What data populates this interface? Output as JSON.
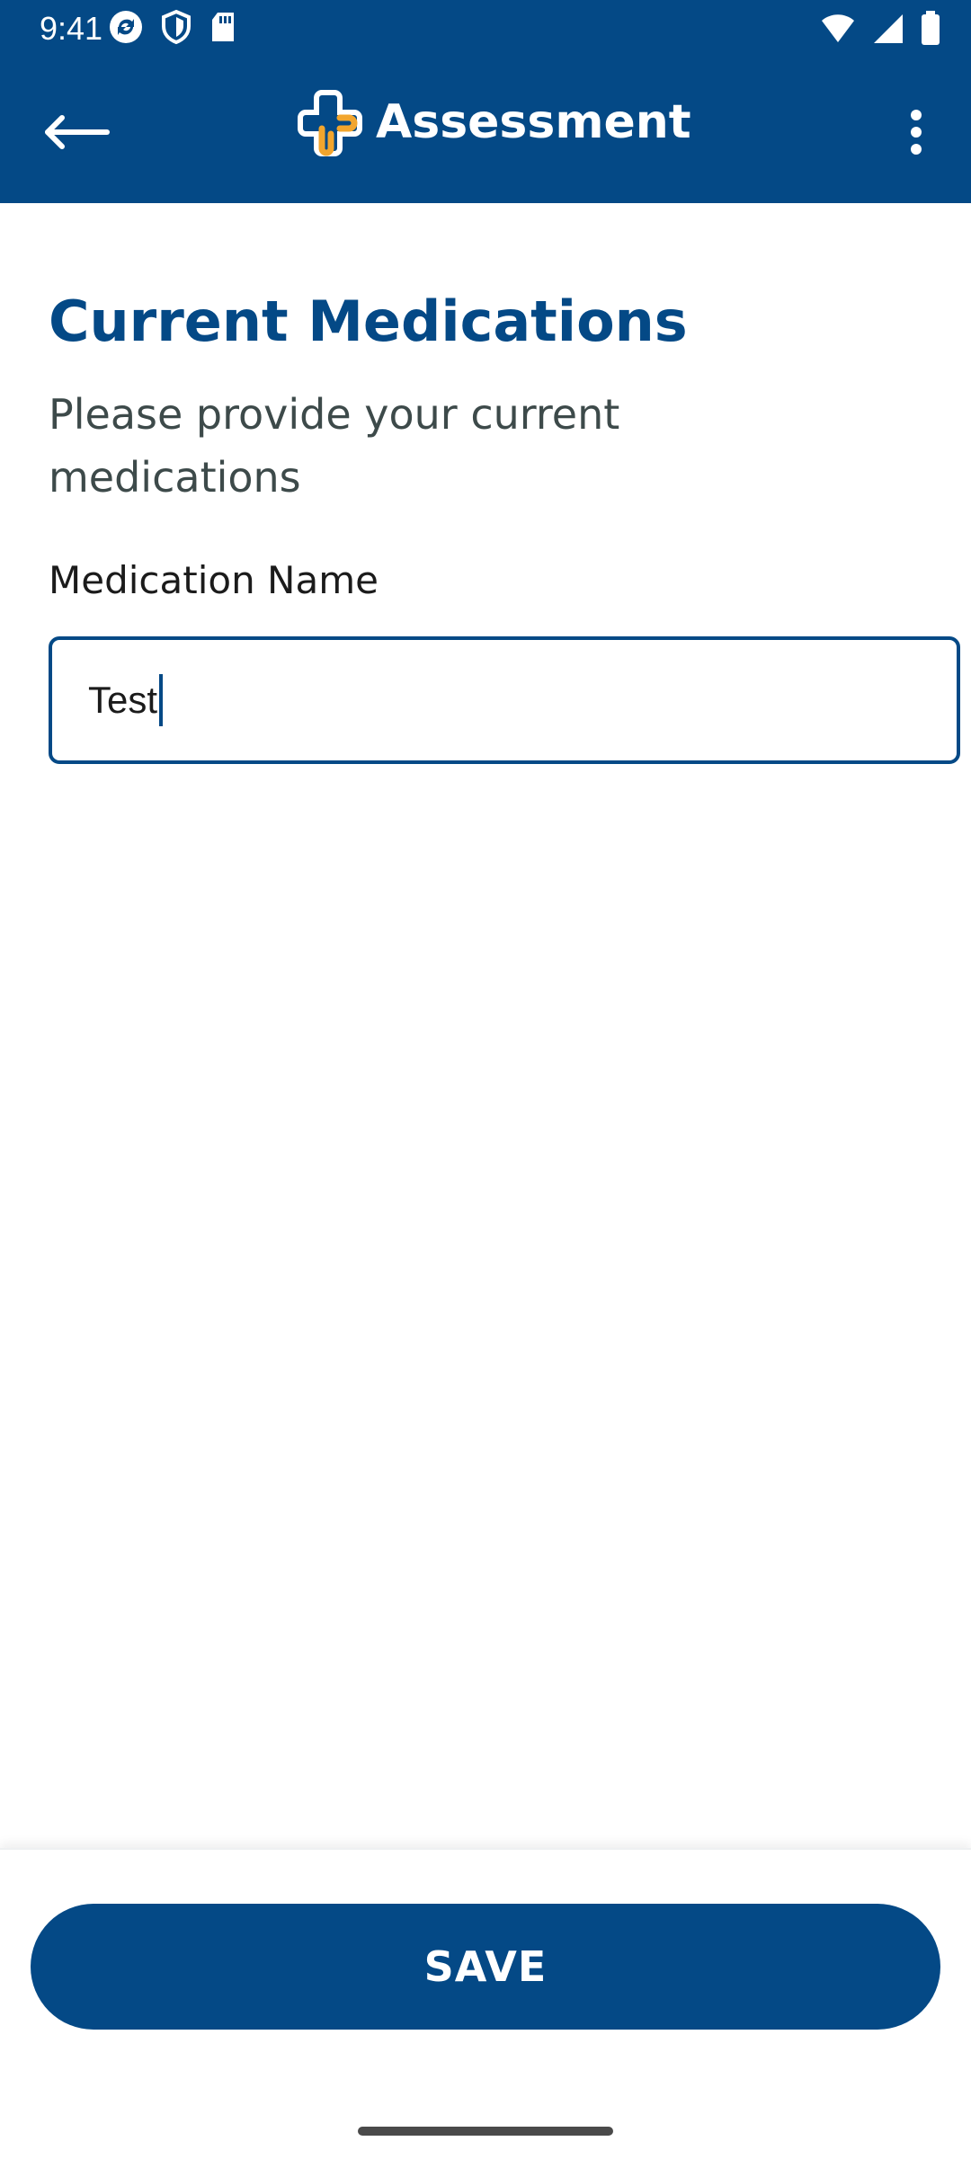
{
  "status_bar": {
    "time": "9:41",
    "icons_left": [
      "sync-icon",
      "shield-icon",
      "sd-card-icon"
    ],
    "icons_right": [
      "wifi-icon",
      "signal-icon",
      "battery-icon"
    ]
  },
  "app_bar": {
    "title": "Assessment",
    "logo_colors": {
      "primary": "#ffffff",
      "accent": "#F2A52D"
    }
  },
  "page": {
    "title": "Current Medications",
    "subtitle": "Please provide your current medications",
    "field": {
      "label": "Medication Name",
      "value": "Test"
    }
  },
  "footer": {
    "save_label": "SAVE"
  },
  "colors": {
    "brand": "#044986",
    "accent": "#F2A52D",
    "background": "#FFFFFF"
  }
}
